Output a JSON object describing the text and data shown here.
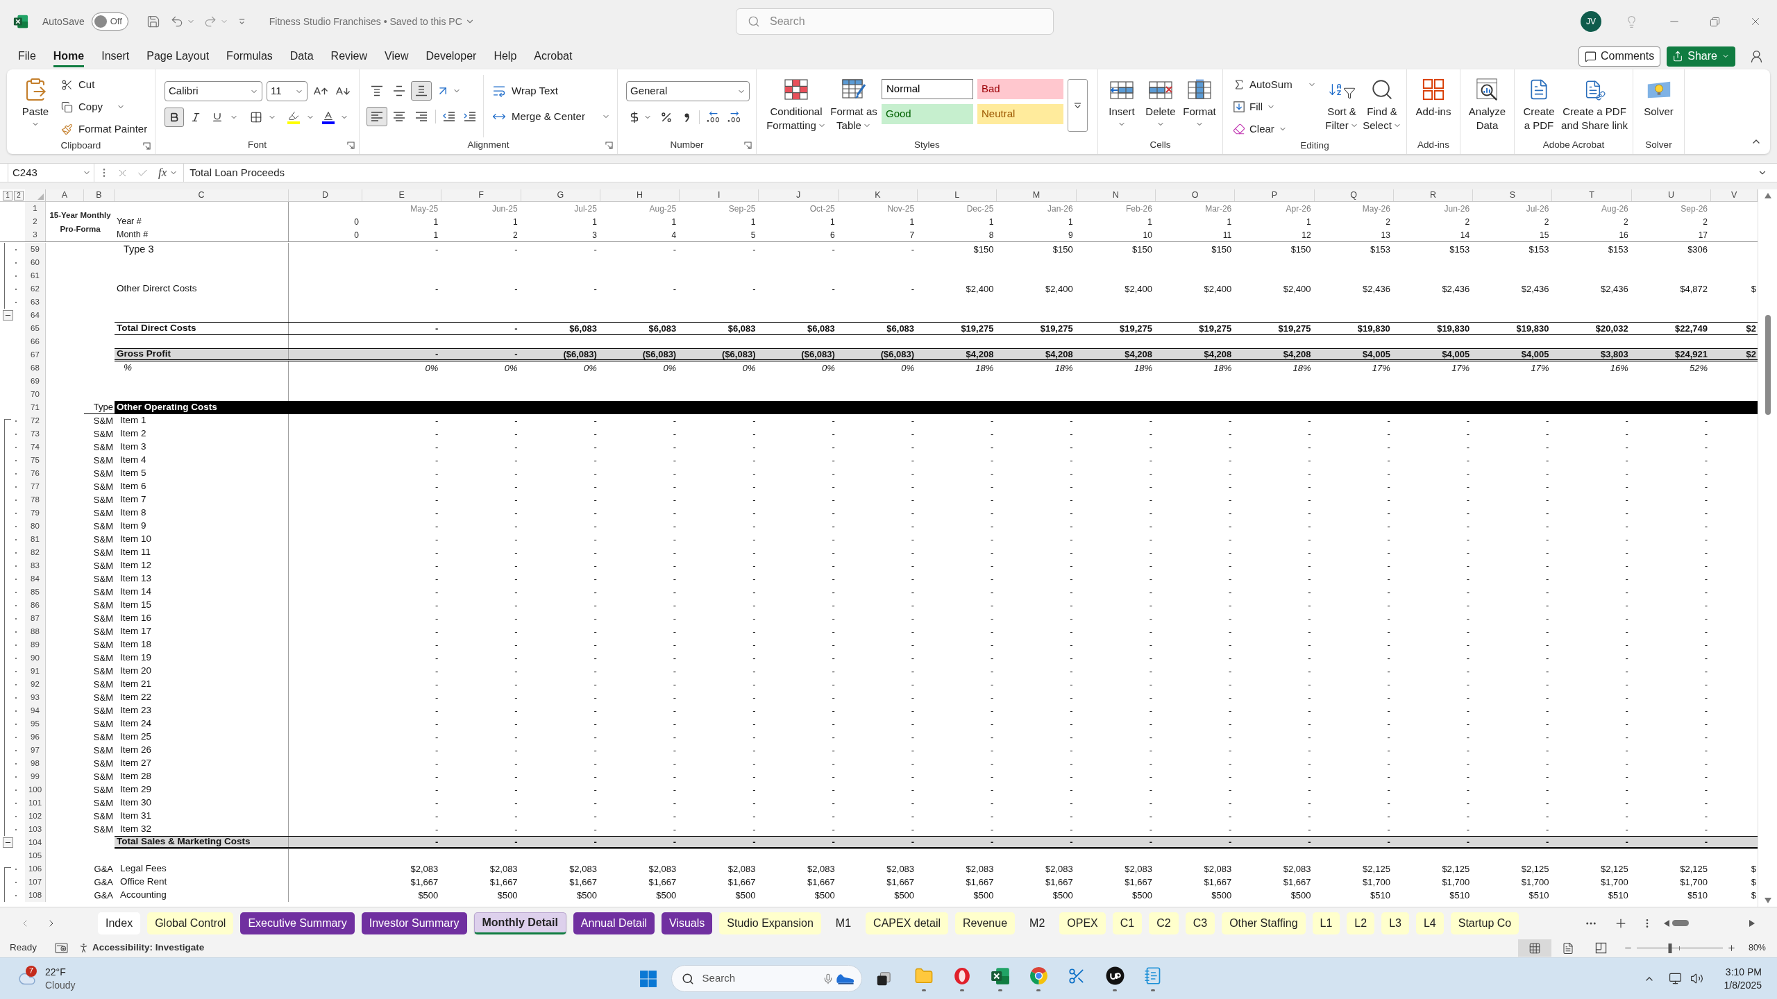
{
  "title_bar": {
    "autosave": {
      "label": "AutoSave",
      "on": false,
      "state_label": "Off"
    },
    "document_title": "Fitness Studio Franchises • Saved to this PC",
    "search": {
      "placeholder": "Search"
    },
    "user_initials": "JV"
  },
  "menu_tabs": [
    {
      "label": "File",
      "selected": false
    },
    {
      "label": "Home",
      "selected": true
    },
    {
      "label": "Insert",
      "selected": false
    },
    {
      "label": "Page Layout",
      "selected": false
    },
    {
      "label": "Formulas",
      "selected": false
    },
    {
      "label": "Data",
      "selected": false
    },
    {
      "label": "Review",
      "selected": false
    },
    {
      "label": "View",
      "selected": false
    },
    {
      "label": "Developer",
      "selected": false
    },
    {
      "label": "Help",
      "selected": false
    },
    {
      "label": "Acrobat",
      "selected": false
    }
  ],
  "header_buttons": {
    "comments": "Comments",
    "share": "Share"
  },
  "ribbon": {
    "clipboard": {
      "label": "Clipboard",
      "paste": "Paste",
      "cut": "Cut",
      "copy": "Copy",
      "format_painter": "Format Painter"
    },
    "font": {
      "label": "Font",
      "font_name": "Calibri",
      "font_size": "11",
      "bold": true
    },
    "alignment": {
      "label": "Alignment",
      "vertical": [
        {
          "kind": "top",
          "selected": false
        },
        {
          "kind": "middle",
          "selected": false
        },
        {
          "kind": "bottom",
          "selected": true
        }
      ],
      "horizontal": [
        {
          "kind": "left",
          "selected": true
        },
        {
          "kind": "center",
          "selected": false
        },
        {
          "kind": "right",
          "selected": false
        }
      ],
      "wrap_text": "Wrap Text",
      "merge_center": "Merge & Center"
    },
    "number": {
      "label": "Number",
      "format": "General"
    },
    "styles": {
      "label": "Styles",
      "conditional_formatting": [
        "Conditional",
        "Formatting"
      ],
      "format_as_table": [
        "Format as",
        "Table"
      ],
      "gallery": [
        {
          "label": "Normal",
          "kind": "normal"
        },
        {
          "label": "Bad",
          "kind": "bad"
        },
        {
          "label": "Good",
          "kind": "good"
        },
        {
          "label": "Neutral",
          "kind": "neutral"
        }
      ]
    },
    "cells": {
      "label": "Cells",
      "buttons": [
        {
          "label": "Insert",
          "kind": "insert"
        },
        {
          "label": "Delete",
          "kind": "delete"
        },
        {
          "label": "Format",
          "kind": "format"
        }
      ]
    },
    "editing": {
      "label": "Editing",
      "autosum": "AutoSum",
      "fill": "Fill",
      "clear": "Clear",
      "sort_filter": [
        "Sort &",
        "Filter"
      ],
      "find_select": [
        "Find &",
        "Select"
      ]
    },
    "add_ins": {
      "label": "Add-ins",
      "button": "Add-ins"
    },
    "analyze": {
      "button": [
        "Analyze",
        "Data"
      ]
    },
    "acrobat": {
      "label": "Adobe Acrobat",
      "create_pdf": [
        "Create",
        "a PDF"
      ],
      "create_share": [
        "Create a PDF",
        "and Share link"
      ]
    },
    "solver": {
      "label": "Solver",
      "button": "Solver"
    }
  },
  "formula_bar": {
    "name_box": "C243",
    "function_label": "fx",
    "formula": "Total Loan Proceeds"
  },
  "sheet": {
    "outline_levels": [
      "1",
      "2"
    ],
    "columns": [
      "A",
      "B",
      "C",
      "D",
      "E",
      "F",
      "G",
      "H",
      "I",
      "J",
      "K",
      "L",
      "M",
      "N",
      "O",
      "P",
      "Q",
      "R",
      "S",
      "T",
      "U",
      "V"
    ],
    "title": "15-Year Monthly Pro-Forma",
    "header_rows": [
      {
        "number": "1",
        "kind": "months",
        "values": [
          "May-25",
          "Jun-25",
          "Jul-25",
          "Aug-25",
          "Sep-25",
          "Oct-25",
          "Nov-25",
          "Dec-25",
          "Jan-26",
          "Feb-26",
          "Mar-26",
          "Apr-26",
          "May-26",
          "Jun-26",
          "Jul-26",
          "Aug-26",
          "Sep-26"
        ]
      },
      {
        "number": "2",
        "kind": "counter",
        "label": "Year #",
        "opening": "0",
        "values": [
          "1",
          "1",
          "1",
          "1",
          "1",
          "1",
          "1",
          "1",
          "1",
          "1",
          "1",
          "1",
          "2",
          "2",
          "2",
          "2",
          "2"
        ]
      },
      {
        "number": "3",
        "kind": "counter",
        "label": "Month #",
        "opening": "0",
        "values": [
          "1",
          "2",
          "3",
          "4",
          "5",
          "6",
          "7",
          "8",
          "9",
          "10",
          "11",
          "12",
          "13",
          "14",
          "15",
          "16",
          "17"
        ]
      }
    ],
    "rows": [
      {
        "number": "59",
        "grouped": true,
        "collapse_button": false,
        "kind": "subitem",
        "label": "Type 3",
        "values": [
          "-",
          "-",
          "-",
          "-",
          "-",
          "-",
          "-",
          "$150",
          "$150",
          "$150",
          "$150",
          "$150",
          "$153",
          "$153",
          "$153",
          "$153",
          "$306"
        ]
      },
      {
        "number": "60",
        "grouped": true,
        "collapse_button": false,
        "kind": "blank"
      },
      {
        "number": "61",
        "grouped": true,
        "collapse_button": false,
        "kind": "blank"
      },
      {
        "number": "62",
        "grouped": true,
        "collapse_button": false,
        "kind": "line",
        "label": "Other Direrct Costs",
        "values": [
          "-",
          "-",
          "-",
          "-",
          "-",
          "-",
          "-",
          "$2,400",
          "$2,400",
          "$2,400",
          "$2,400",
          "$2,400",
          "$2,436",
          "$2,436",
          "$2,436",
          "$2,436",
          "$4,872"
        ],
        "overflow": "$"
      },
      {
        "number": "63",
        "grouped": true,
        "collapse_button": false,
        "kind": "blank"
      },
      {
        "number": "64",
        "grouped": false,
        "collapse_button": true,
        "kind": "blank"
      },
      {
        "number": "65",
        "grouped": false,
        "collapse_button": false,
        "kind": "total",
        "label": "Total Direct Costs",
        "values": [
          "-",
          "-",
          "$6,083",
          "$6,083",
          "$6,083",
          "$6,083",
          "$6,083",
          "$19,275",
          "$19,275",
          "$19,275",
          "$19,275",
          "$19,275",
          "$19,830",
          "$19,830",
          "$19,830",
          "$20,032",
          "$22,749"
        ],
        "overflow": "$2"
      },
      {
        "number": "66",
        "grouped": false,
        "collapse_button": false,
        "kind": "blank"
      },
      {
        "number": "67",
        "grouped": false,
        "collapse_button": false,
        "kind": "gross",
        "label": "Gross Profit",
        "values": [
          "-",
          "-",
          "($6,083)",
          "($6,083)",
          "($6,083)",
          "($6,083)",
          "($6,083)",
          "$4,208",
          "$4,208",
          "$4,208",
          "$4,208",
          "$4,208",
          "$4,005",
          "$4,005",
          "$4,005",
          "$3,803",
          "$24,921"
        ],
        "overflow": "$2"
      },
      {
        "number": "68",
        "grouped": false,
        "collapse_button": false,
        "kind": "percent",
        "label": "%",
        "values": [
          "0%",
          "0%",
          "0%",
          "0%",
          "0%",
          "0%",
          "0%",
          "18%",
          "18%",
          "18%",
          "18%",
          "18%",
          "17%",
          "17%",
          "17%",
          "16%",
          "52%"
        ]
      },
      {
        "number": "69",
        "grouped": false,
        "collapse_button": false,
        "kind": "blank"
      },
      {
        "number": "70",
        "grouped": false,
        "collapse_button": false,
        "kind": "blank"
      },
      {
        "number": "71",
        "grouped": false,
        "collapse_button": false,
        "kind": "section",
        "type": "Type",
        "label": "Other Operating Costs"
      },
      {
        "number": "72",
        "grouped": true,
        "collapse_button": false,
        "kind": "item",
        "type": "S&M",
        "label": "Item 1",
        "values": [
          "-",
          "-",
          "-",
          "-",
          "-",
          "-",
          "-",
          "-",
          "-",
          "-",
          "-",
          "-",
          "-",
          "-",
          "-",
          "-",
          "-"
        ]
      },
      {
        "number": "73",
        "grouped": true,
        "collapse_button": false,
        "kind": "item",
        "type": "S&M",
        "label": "Item 2",
        "values": [
          "-",
          "-",
          "-",
          "-",
          "-",
          "-",
          "-",
          "-",
          "-",
          "-",
          "-",
          "-",
          "-",
          "-",
          "-",
          "-",
          "-"
        ]
      },
      {
        "number": "74",
        "grouped": true,
        "collapse_button": false,
        "kind": "item",
        "type": "S&M",
        "label": "Item 3",
        "values": [
          "-",
          "-",
          "-",
          "-",
          "-",
          "-",
          "-",
          "-",
          "-",
          "-",
          "-",
          "-",
          "-",
          "-",
          "-",
          "-",
          "-"
        ]
      },
      {
        "number": "75",
        "grouped": true,
        "collapse_button": false,
        "kind": "item",
        "type": "S&M",
        "label": "Item 4",
        "values": [
          "-",
          "-",
          "-",
          "-",
          "-",
          "-",
          "-",
          "-",
          "-",
          "-",
          "-",
          "-",
          "-",
          "-",
          "-",
          "-",
          "-"
        ]
      },
      {
        "number": "76",
        "grouped": true,
        "collapse_button": false,
        "kind": "item",
        "type": "S&M",
        "label": "Item 5",
        "values": [
          "-",
          "-",
          "-",
          "-",
          "-",
          "-",
          "-",
          "-",
          "-",
          "-",
          "-",
          "-",
          "-",
          "-",
          "-",
          "-",
          "-"
        ]
      },
      {
        "number": "77",
        "grouped": true,
        "collapse_button": false,
        "kind": "item",
        "type": "S&M",
        "label": "Item 6",
        "values": [
          "-",
          "-",
          "-",
          "-",
          "-",
          "-",
          "-",
          "-",
          "-",
          "-",
          "-",
          "-",
          "-",
          "-",
          "-",
          "-",
          "-"
        ]
      },
      {
        "number": "78",
        "grouped": true,
        "collapse_button": false,
        "kind": "item",
        "type": "S&M",
        "label": "Item 7",
        "values": [
          "-",
          "-",
          "-",
          "-",
          "-",
          "-",
          "-",
          "-",
          "-",
          "-",
          "-",
          "-",
          "-",
          "-",
          "-",
          "-",
          "-"
        ]
      },
      {
        "number": "79",
        "grouped": true,
        "collapse_button": false,
        "kind": "item",
        "type": "S&M",
        "label": "Item 8",
        "values": [
          "-",
          "-",
          "-",
          "-",
          "-",
          "-",
          "-",
          "-",
          "-",
          "-",
          "-",
          "-",
          "-",
          "-",
          "-",
          "-",
          "-"
        ]
      },
      {
        "number": "80",
        "grouped": true,
        "collapse_button": false,
        "kind": "item",
        "type": "S&M",
        "label": "Item 9",
        "values": [
          "-",
          "-",
          "-",
          "-",
          "-",
          "-",
          "-",
          "-",
          "-",
          "-",
          "-",
          "-",
          "-",
          "-",
          "-",
          "-",
          "-"
        ]
      },
      {
        "number": "81",
        "grouped": true,
        "collapse_button": false,
        "kind": "item",
        "type": "S&M",
        "label": "Item 10",
        "values": [
          "-",
          "-",
          "-",
          "-",
          "-",
          "-",
          "-",
          "-",
          "-",
          "-",
          "-",
          "-",
          "-",
          "-",
          "-",
          "-",
          "-"
        ]
      },
      {
        "number": "82",
        "grouped": true,
        "collapse_button": false,
        "kind": "item",
        "type": "S&M",
        "label": "Item 11",
        "values": [
          "-",
          "-",
          "-",
          "-",
          "-",
          "-",
          "-",
          "-",
          "-",
          "-",
          "-",
          "-",
          "-",
          "-",
          "-",
          "-",
          "-"
        ]
      },
      {
        "number": "83",
        "grouped": true,
        "collapse_button": false,
        "kind": "item",
        "type": "S&M",
        "label": "Item 12",
        "values": [
          "-",
          "-",
          "-",
          "-",
          "-",
          "-",
          "-",
          "-",
          "-",
          "-",
          "-",
          "-",
          "-",
          "-",
          "-",
          "-",
          "-"
        ]
      },
      {
        "number": "84",
        "grouped": true,
        "collapse_button": false,
        "kind": "item",
        "type": "S&M",
        "label": "Item 13",
        "values": [
          "-",
          "-",
          "-",
          "-",
          "-",
          "-",
          "-",
          "-",
          "-",
          "-",
          "-",
          "-",
          "-",
          "-",
          "-",
          "-",
          "-"
        ]
      },
      {
        "number": "85",
        "grouped": true,
        "collapse_button": false,
        "kind": "item",
        "type": "S&M",
        "label": "Item 14",
        "values": [
          "-",
          "-",
          "-",
          "-",
          "-",
          "-",
          "-",
          "-",
          "-",
          "-",
          "-",
          "-",
          "-",
          "-",
          "-",
          "-",
          "-"
        ]
      },
      {
        "number": "86",
        "grouped": true,
        "collapse_button": false,
        "kind": "item",
        "type": "S&M",
        "label": "Item 15",
        "values": [
          "-",
          "-",
          "-",
          "-",
          "-",
          "-",
          "-",
          "-",
          "-",
          "-",
          "-",
          "-",
          "-",
          "-",
          "-",
          "-",
          "-"
        ]
      },
      {
        "number": "87",
        "grouped": true,
        "collapse_button": false,
        "kind": "item",
        "type": "S&M",
        "label": "Item 16",
        "values": [
          "-",
          "-",
          "-",
          "-",
          "-",
          "-",
          "-",
          "-",
          "-",
          "-",
          "-",
          "-",
          "-",
          "-",
          "-",
          "-",
          "-"
        ]
      },
      {
        "number": "88",
        "grouped": true,
        "collapse_button": false,
        "kind": "item",
        "type": "S&M",
        "label": "Item 17",
        "values": [
          "-",
          "-",
          "-",
          "-",
          "-",
          "-",
          "-",
          "-",
          "-",
          "-",
          "-",
          "-",
          "-",
          "-",
          "-",
          "-",
          "-"
        ]
      },
      {
        "number": "89",
        "grouped": true,
        "collapse_button": false,
        "kind": "item",
        "type": "S&M",
        "label": "Item 18",
        "values": [
          "-",
          "-",
          "-",
          "-",
          "-",
          "-",
          "-",
          "-",
          "-",
          "-",
          "-",
          "-",
          "-",
          "-",
          "-",
          "-",
          "-"
        ]
      },
      {
        "number": "90",
        "grouped": true,
        "collapse_button": false,
        "kind": "item",
        "type": "S&M",
        "label": "Item 19",
        "values": [
          "-",
          "-",
          "-",
          "-",
          "-",
          "-",
          "-",
          "-",
          "-",
          "-",
          "-",
          "-",
          "-",
          "-",
          "-",
          "-",
          "-"
        ]
      },
      {
        "number": "91",
        "grouped": true,
        "collapse_button": false,
        "kind": "item",
        "type": "S&M",
        "label": "Item 20",
        "values": [
          "-",
          "-",
          "-",
          "-",
          "-",
          "-",
          "-",
          "-",
          "-",
          "-",
          "-",
          "-",
          "-",
          "-",
          "-",
          "-",
          "-"
        ]
      },
      {
        "number": "92",
        "grouped": true,
        "collapse_button": false,
        "kind": "item",
        "type": "S&M",
        "label": "Item 21",
        "values": [
          "-",
          "-",
          "-",
          "-",
          "-",
          "-",
          "-",
          "-",
          "-",
          "-",
          "-",
          "-",
          "-",
          "-",
          "-",
          "-",
          "-"
        ]
      },
      {
        "number": "93",
        "grouped": true,
        "collapse_button": false,
        "kind": "item",
        "type": "S&M",
        "label": "Item 22",
        "values": [
          "-",
          "-",
          "-",
          "-",
          "-",
          "-",
          "-",
          "-",
          "-",
          "-",
          "-",
          "-",
          "-",
          "-",
          "-",
          "-",
          "-"
        ]
      },
      {
        "number": "94",
        "grouped": true,
        "collapse_button": false,
        "kind": "item",
        "type": "S&M",
        "label": "Item 23",
        "values": [
          "-",
          "-",
          "-",
          "-",
          "-",
          "-",
          "-",
          "-",
          "-",
          "-",
          "-",
          "-",
          "-",
          "-",
          "-",
          "-",
          "-"
        ]
      },
      {
        "number": "95",
        "grouped": true,
        "collapse_button": false,
        "kind": "item",
        "type": "S&M",
        "label": "Item 24",
        "values": [
          "-",
          "-",
          "-",
          "-",
          "-",
          "-",
          "-",
          "-",
          "-",
          "-",
          "-",
          "-",
          "-",
          "-",
          "-",
          "-",
          "-"
        ]
      },
      {
        "number": "96",
        "grouped": true,
        "collapse_button": false,
        "kind": "item",
        "type": "S&M",
        "label": "Item 25",
        "values": [
          "-",
          "-",
          "-",
          "-",
          "-",
          "-",
          "-",
          "-",
          "-",
          "-",
          "-",
          "-",
          "-",
          "-",
          "-",
          "-",
          "-"
        ]
      },
      {
        "number": "97",
        "grouped": true,
        "collapse_button": false,
        "kind": "item",
        "type": "S&M",
        "label": "Item 26",
        "values": [
          "-",
          "-",
          "-",
          "-",
          "-",
          "-",
          "-",
          "-",
          "-",
          "-",
          "-",
          "-",
          "-",
          "-",
          "-",
          "-",
          "-"
        ]
      },
      {
        "number": "98",
        "grouped": true,
        "collapse_button": false,
        "kind": "item",
        "type": "S&M",
        "label": "Item 27",
        "values": [
          "-",
          "-",
          "-",
          "-",
          "-",
          "-",
          "-",
          "-",
          "-",
          "-",
          "-",
          "-",
          "-",
          "-",
          "-",
          "-",
          "-"
        ]
      },
      {
        "number": "99",
        "grouped": true,
        "collapse_button": false,
        "kind": "item",
        "type": "S&M",
        "label": "Item 28",
        "values": [
          "-",
          "-",
          "-",
          "-",
          "-",
          "-",
          "-",
          "-",
          "-",
          "-",
          "-",
          "-",
          "-",
          "-",
          "-",
          "-",
          "-"
        ]
      },
      {
        "number": "100",
        "grouped": true,
        "collapse_button": false,
        "kind": "item",
        "type": "S&M",
        "label": "Item 29",
        "values": [
          "-",
          "-",
          "-",
          "-",
          "-",
          "-",
          "-",
          "-",
          "-",
          "-",
          "-",
          "-",
          "-",
          "-",
          "-",
          "-",
          "-"
        ]
      },
      {
        "number": "101",
        "grouped": true,
        "collapse_button": false,
        "kind": "item",
        "type": "S&M",
        "label": "Item 30",
        "values": [
          "-",
          "-",
          "-",
          "-",
          "-",
          "-",
          "-",
          "-",
          "-",
          "-",
          "-",
          "-",
          "-",
          "-",
          "-",
          "-",
          "-"
        ]
      },
      {
        "number": "102",
        "grouped": true,
        "collapse_button": false,
        "kind": "item",
        "type": "S&M",
        "label": "Item 31",
        "values": [
          "-",
          "-",
          "-",
          "-",
          "-",
          "-",
          "-",
          "-",
          "-",
          "-",
          "-",
          "-",
          "-",
          "-",
          "-",
          "-",
          "-"
        ]
      },
      {
        "number": "103",
        "grouped": true,
        "collapse_button": false,
        "kind": "item",
        "type": "S&M",
        "label": "Item 32",
        "values": [
          "-",
          "-",
          "-",
          "-",
          "-",
          "-",
          "-",
          "-",
          "-",
          "-",
          "-",
          "-",
          "-",
          "-",
          "-",
          "-",
          "-"
        ]
      },
      {
        "number": "104",
        "grouped": false,
        "collapse_button": true,
        "kind": "subtotal",
        "label": "Total Sales & Marketing Costs",
        "values": [
          "-",
          "-",
          "-",
          "-",
          "-",
          "-",
          "-",
          "-",
          "-",
          "-",
          "-",
          "-",
          "-",
          "-",
          "-",
          "-",
          "-"
        ]
      },
      {
        "number": "105",
        "grouped": false,
        "collapse_button": false,
        "kind": "blank"
      },
      {
        "number": "106",
        "grouped": true,
        "collapse_button": false,
        "kind": "item",
        "type": "G&A",
        "label": "Legal Fees",
        "values": [
          "$2,083",
          "$2,083",
          "$2,083",
          "$2,083",
          "$2,083",
          "$2,083",
          "$2,083",
          "$2,083",
          "$2,083",
          "$2,083",
          "$2,083",
          "$2,083",
          "$2,125",
          "$2,125",
          "$2,125",
          "$2,125",
          "$2,125"
        ],
        "overflow": "$"
      },
      {
        "number": "107",
        "grouped": true,
        "collapse_button": false,
        "kind": "item",
        "type": "G&A",
        "label": "Office Rent",
        "values": [
          "$1,667",
          "$1,667",
          "$1,667",
          "$1,667",
          "$1,667",
          "$1,667",
          "$1,667",
          "$1,667",
          "$1,667",
          "$1,667",
          "$1,667",
          "$1,667",
          "$1,700",
          "$1,700",
          "$1,700",
          "$1,700",
          "$1,700"
        ],
        "overflow": "$"
      },
      {
        "number": "108",
        "grouped": true,
        "collapse_button": false,
        "kind": "item",
        "type": "G&A",
        "label": "Accounting",
        "values": [
          "$500",
          "$500",
          "$500",
          "$500",
          "$500",
          "$500",
          "$500",
          "$500",
          "$500",
          "$500",
          "$500",
          "$500",
          "$510",
          "$510",
          "$510",
          "$510",
          "$510"
        ],
        "overflow": "$"
      }
    ]
  },
  "sheet_tabs": [
    {
      "label": "Index",
      "color": "#ffffff",
      "selected": false
    },
    {
      "label": "Global Control",
      "color": "#ffffcc",
      "selected": false
    },
    {
      "label": "Executive Summary",
      "color": "#7030a0",
      "selected": false
    },
    {
      "label": "Investor Summary",
      "color": "#7030a0",
      "selected": false
    },
    {
      "label": "Monthly Detail",
      "color": "#ddd0ec",
      "selected": true
    },
    {
      "label": "Annual Detail",
      "color": "#7030a0",
      "selected": false
    },
    {
      "label": "Visuals",
      "color": "#7030a0",
      "selected": false
    },
    {
      "label": "Studio Expansion",
      "color": "#ffffcc",
      "selected": false
    },
    {
      "label": "M1",
      "selected": false
    },
    {
      "label": "CAPEX detail",
      "color": "#ffffcc",
      "selected": false
    },
    {
      "label": "Revenue",
      "color": "#ffffcc",
      "selected": false
    },
    {
      "label": "M2",
      "selected": false
    },
    {
      "label": "OPEX",
      "color": "#ffffcc",
      "selected": false
    },
    {
      "label": "C1",
      "color": "#ffffcc",
      "selected": false
    },
    {
      "label": "C2",
      "color": "#ffffcc",
      "selected": false
    },
    {
      "label": "C3",
      "color": "#ffffcc",
      "selected": false
    },
    {
      "label": "Other Staffing",
      "color": "#ffffcc",
      "selected": false
    },
    {
      "label": "L1",
      "color": "#ffffcc",
      "selected": false
    },
    {
      "label": "L2",
      "color": "#ffffcc",
      "selected": false
    },
    {
      "label": "L3",
      "color": "#ffffcc",
      "selected": false
    },
    {
      "label": "L4",
      "color": "#ffffcc",
      "selected": false
    },
    {
      "label": "Startup Co",
      "color": "#ffffcc",
      "selected": false
    }
  ],
  "status_bar": {
    "status": "Ready",
    "accessibility": "Accessibility: Investigate",
    "views": [
      {
        "kind": "normal",
        "selected": true
      },
      {
        "kind": "page_layout",
        "selected": false
      },
      {
        "kind": "page_break",
        "selected": false
      }
    ],
    "zoom": {
      "level": 0.39,
      "reading": "80%"
    }
  },
  "taskbar": {
    "weather": {
      "badge": "7",
      "temperature": "22°F",
      "condition": "Cloudy"
    },
    "search": {
      "placeholder": "Search"
    },
    "apps": [
      {
        "kind": "folder",
        "running": true
      },
      {
        "kind": "ring",
        "running": true
      },
      {
        "kind": "spreadsheet",
        "running": true
      },
      {
        "kind": "browser",
        "running": true
      },
      {
        "kind": "snip",
        "running": false
      },
      {
        "kind": "round_logo",
        "running": true
      },
      {
        "kind": "notepad",
        "running": true
      }
    ],
    "clock": {
      "time": "3:10 PM",
      "date": "1/8/2025"
    }
  }
}
